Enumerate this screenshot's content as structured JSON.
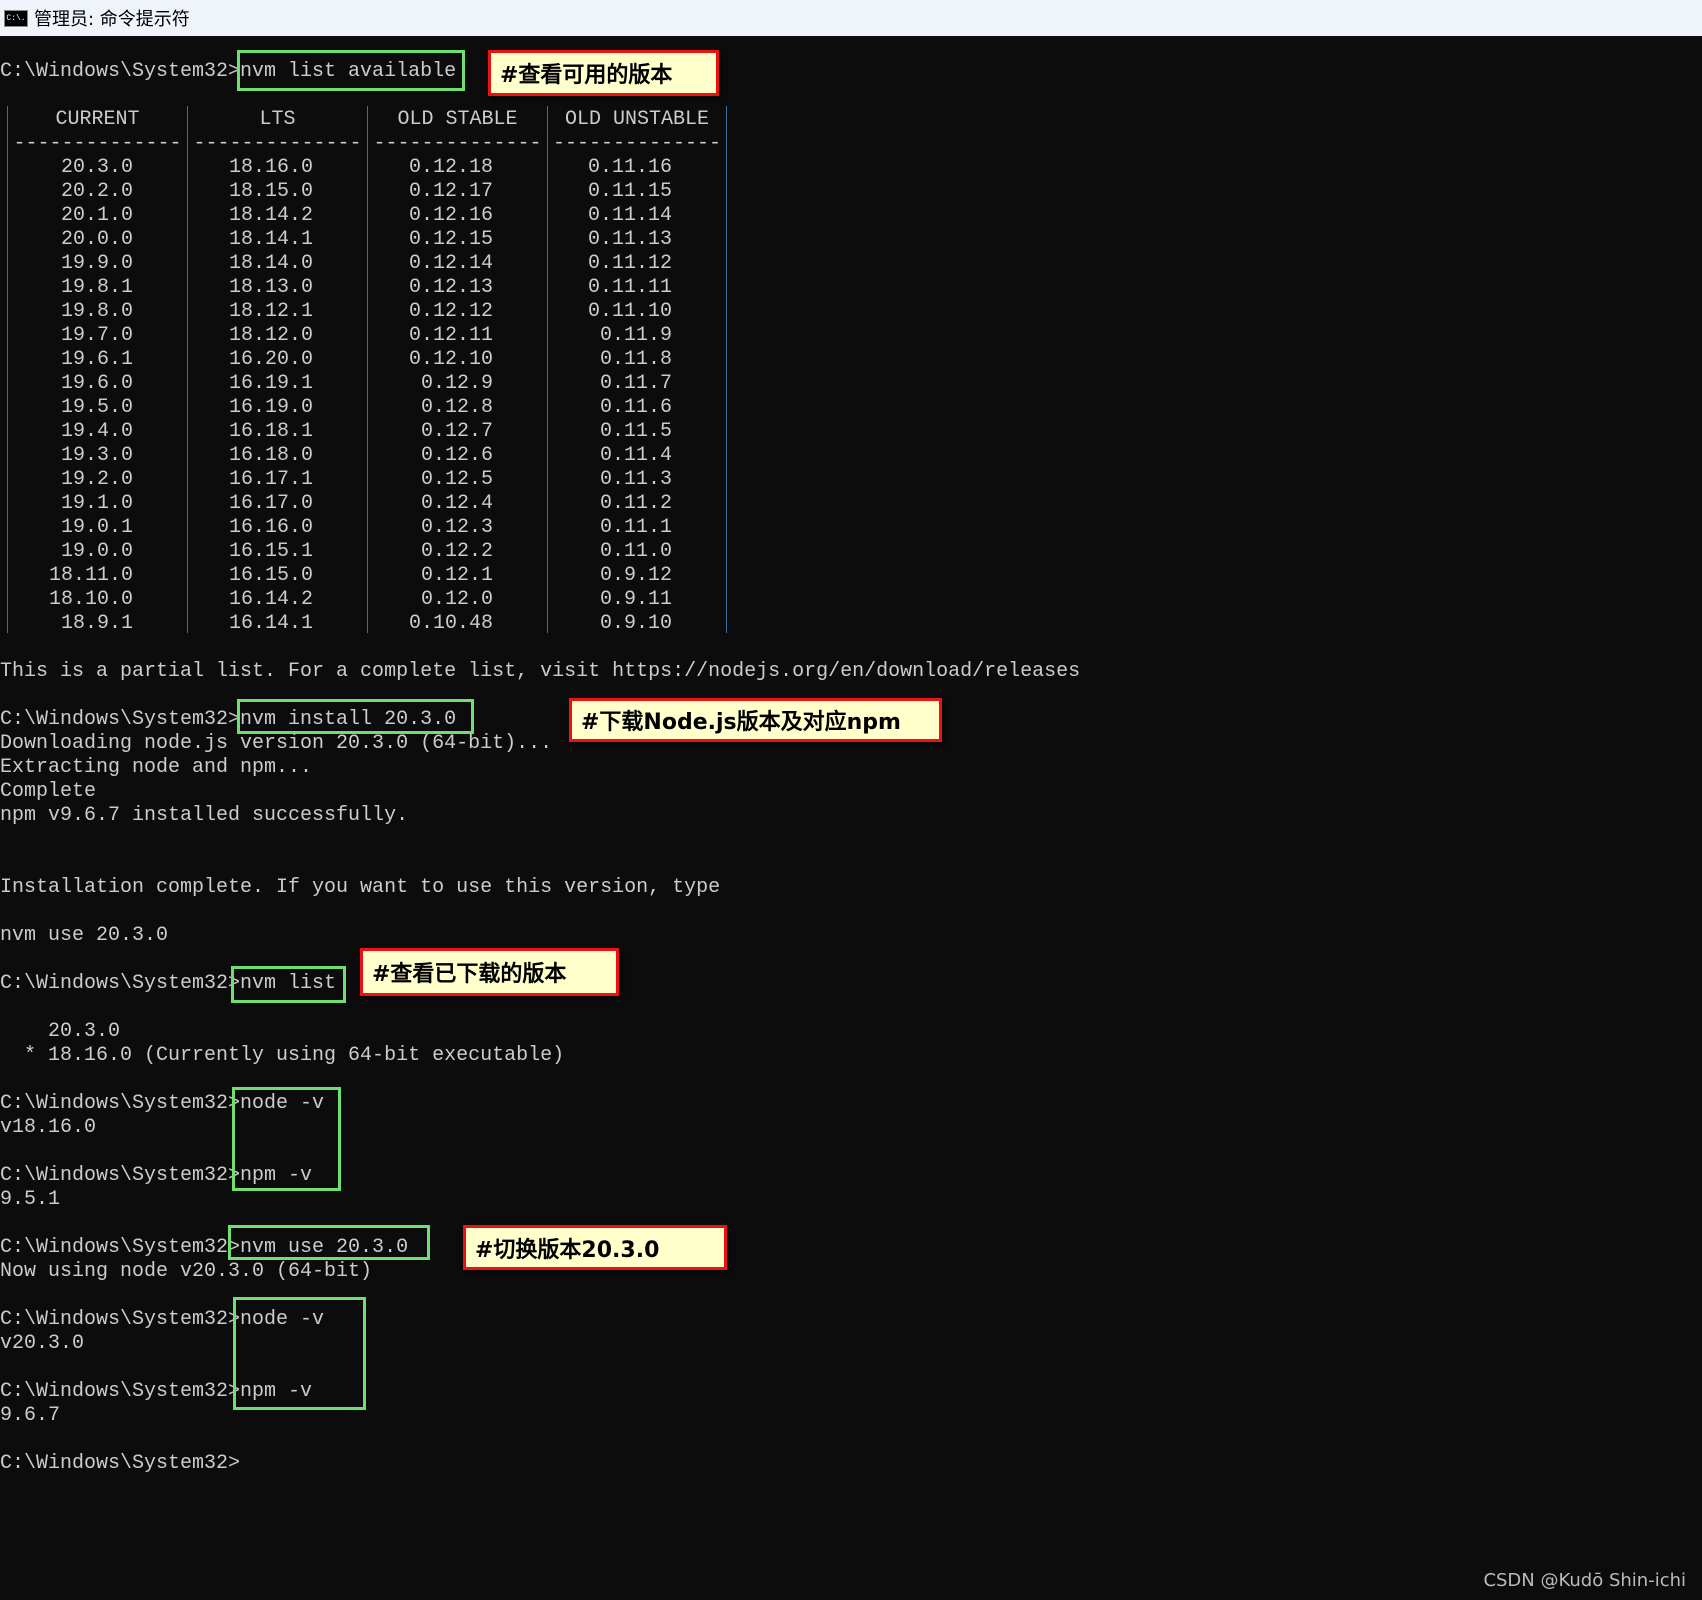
{
  "window": {
    "title": "管理员: 命令提示符",
    "icon": "cmd-icon"
  },
  "table": {
    "headers": [
      "CURRENT",
      "LTS",
      "OLD STABLE",
      "OLD UNSTABLE"
    ],
    "dashes": "--------------",
    "columns": [
      [
        "20.3.0",
        "20.2.0",
        "20.1.0",
        "20.0.0",
        "19.9.0",
        "19.8.1",
        "19.8.0",
        "19.7.0",
        "19.6.1",
        "19.6.0",
        "19.5.0",
        "19.4.0",
        "19.3.0",
        "19.2.0",
        "19.1.0",
        "19.0.1",
        "19.0.0",
        "18.11.0",
        "18.10.0",
        "18.9.1"
      ],
      [
        "18.16.0",
        "18.15.0",
        "18.14.2",
        "18.14.1",
        "18.14.0",
        "18.13.0",
        "18.12.1",
        "18.12.0",
        "16.20.0",
        "16.19.1",
        "16.19.0",
        "16.18.1",
        "16.18.0",
        "16.17.1",
        "16.17.0",
        "16.16.0",
        "16.15.1",
        "16.15.0",
        "16.14.2",
        "16.14.1"
      ],
      [
        "0.12.18",
        "0.12.17",
        "0.12.16",
        "0.12.15",
        "0.12.14",
        "0.12.13",
        "0.12.12",
        "0.12.11",
        "0.12.10",
        "0.12.9",
        "0.12.8",
        "0.12.7",
        "0.12.6",
        "0.12.5",
        "0.12.4",
        "0.12.3",
        "0.12.2",
        "0.12.1",
        "0.12.0",
        "0.10.48"
      ],
      [
        "0.11.16",
        "0.11.15",
        "0.11.14",
        "0.11.13",
        "0.11.12",
        "0.11.11",
        "0.11.10",
        "0.11.9",
        "0.11.8",
        "0.11.7",
        "0.11.6",
        "0.11.5",
        "0.11.4",
        "0.11.3",
        "0.11.2",
        "0.11.1",
        "0.11.0",
        "0.9.12",
        "0.9.11",
        "0.9.10"
      ]
    ]
  },
  "lines": {
    "l0": "C:\\Windows\\System32>nvm list available",
    "l25": "This is a partial list. For a complete list, visit https://nodejs.org/en/download/releases",
    "l27": "C:\\Windows\\System32>nvm install 20.3.0",
    "l28": "Downloading node.js version 20.3.0 (64-bit)...",
    "l29": "Extracting node and npm...",
    "l30": "Complete",
    "l31": "npm v9.6.7 installed successfully.",
    "l34": "Installation complete. If you want to use this version, type",
    "l36": "nvm use 20.3.0",
    "l38": "C:\\Windows\\System32>nvm list",
    "l40": "    20.3.0",
    "l41": "  * 18.16.0 (Currently using 64-bit executable)",
    "l43": "C:\\Windows\\System32>node -v",
    "l44": "v18.16.0",
    "l46": "C:\\Windows\\System32>npm -v",
    "l47": "9.5.1",
    "l49": "C:\\Windows\\System32>nvm use 20.3.0",
    "l50": "Now using node v20.3.0 (64-bit)",
    "l52": "C:\\Windows\\System32>node -v",
    "l53": "v20.3.0",
    "l55": "C:\\Windows\\System32>npm -v",
    "l56": "9.6.7",
    "l58": "C:\\Windows\\System32>"
  },
  "annotations": {
    "a1": "#查看可用的版本",
    "a2": "#下载Node.js版本及对应npm",
    "a3": "#查看已下载的版本",
    "a4": "#切换版本20.3.0"
  },
  "colors": {
    "highlight_box": "#6fe06f",
    "note_border": "#ee1111",
    "note_bg": "#ffffcc",
    "terminal_bg": "#0c0c0c",
    "terminal_text": "#cccccc"
  },
  "watermark": "CSDN @Kudō Shin-ichi"
}
